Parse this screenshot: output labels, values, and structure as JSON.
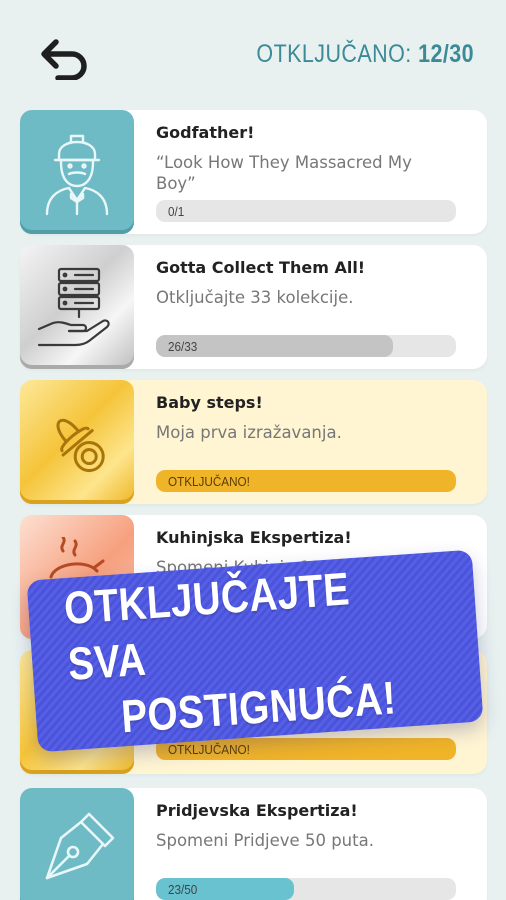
{
  "header": {
    "counter_label": "OTKLJUČANO:",
    "counter_value": "12/30"
  },
  "achievements": [
    {
      "title": "Godfather!",
      "description": "“Look How They Massacred My Boy”",
      "progress_text": "0/1",
      "progress": 0.0,
      "icon": "businessman-icon"
    },
    {
      "title": "Gotta Collect Them All!",
      "description": "Otključajte 33 kolekcije.",
      "progress_text": "26/33",
      "progress": 0.79,
      "icon": "server-hand-icon"
    },
    {
      "title": "Baby steps!",
      "description": "Moja prva izražavanja.",
      "progress_text": "OTKLJUČANO!",
      "progress": 1.0,
      "icon": "pacifier-icon"
    },
    {
      "title": "Kuhinjska Ekspertiza!",
      "description": "Spomeni Kuhinju 100",
      "progress_text": "",
      "progress": 0.0,
      "icon": "cooking-pot-icon"
    },
    {
      "title": "",
      "description": "",
      "progress_text": "OTKLJUČANO!",
      "progress": 1.0,
      "icon": "gold-achievement-icon"
    },
    {
      "title": "Pridjevska Ekspertiza!",
      "description": "Spomeni Pridjeve 50 puta.",
      "progress_text": "23/50",
      "progress": 0.46,
      "icon": "fountain-pen-icon"
    }
  ],
  "banner": {
    "line1": "OTKLJUČAJTE SVA",
    "line2": "POSTIGNUĆA!"
  },
  "colors": {
    "background": "#e8f1f0",
    "accent": "#3b8a97",
    "banner": "#4b53dc",
    "gold": "#f0b429",
    "teal": "#68c2cf"
  }
}
